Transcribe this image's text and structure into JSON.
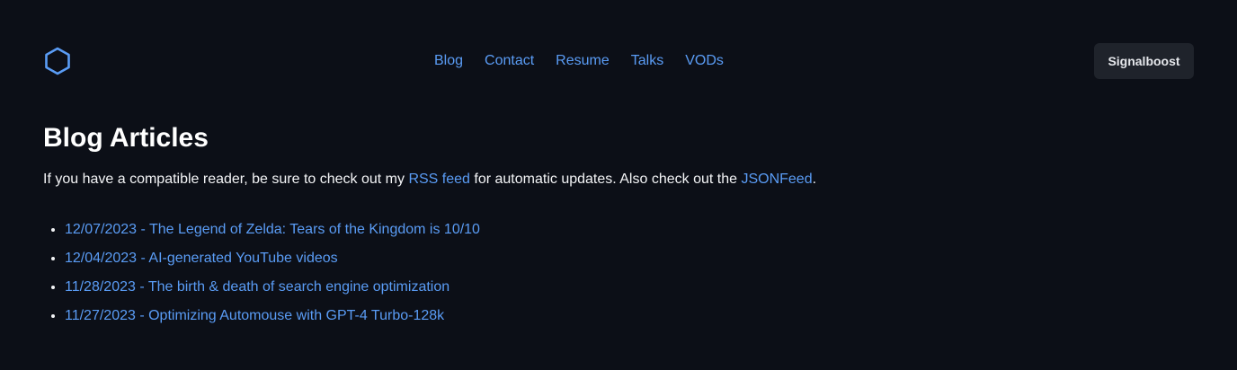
{
  "header": {
    "logo_icon": "hexagon-icon",
    "accent_color": "#5a9cf5",
    "nav": [
      {
        "label": "Blog"
      },
      {
        "label": "Contact"
      },
      {
        "label": "Resume"
      },
      {
        "label": "Talks"
      },
      {
        "label": "VODs"
      }
    ],
    "signalboost_label": "Signalboost"
  },
  "main": {
    "title": "Blog Articles",
    "intro": {
      "before_rss": "If you have a compatible reader, be sure to check out my ",
      "rss_link": "RSS feed",
      "between": " for automatic updates. Also check out the ",
      "json_link": "JSONFeed",
      "after": "."
    },
    "articles": [
      {
        "label": "12/07/2023 - The Legend of Zelda: Tears of the Kingdom is 10/10"
      },
      {
        "label": "12/04/2023 - AI-generated YouTube videos"
      },
      {
        "label": "11/28/2023 - The birth & death of search engine optimization"
      },
      {
        "label": "11/27/2023 - Optimizing Automouse with GPT-4 Turbo-128k"
      }
    ]
  }
}
